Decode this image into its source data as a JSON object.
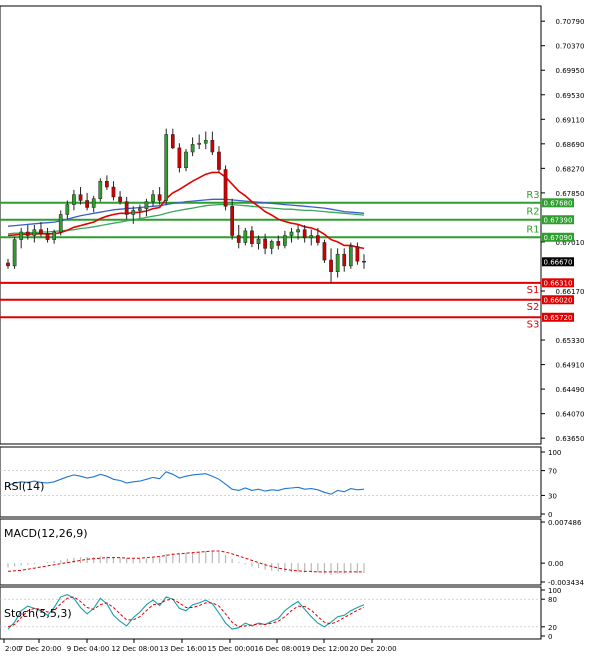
{
  "chart_data": {
    "type": "candlestick",
    "main": {
      "y_ticks": [
        "0.70790",
        "0.70370",
        "0.69950",
        "0.69530",
        "0.69110",
        "0.68690",
        "0.68270",
        "0.67850",
        "0.67010",
        "0.66170",
        "0.65330",
        "0.64910",
        "0.64490",
        "0.64070",
        "0.63650"
      ],
      "ylim": [
        0.6355,
        0.7105
      ],
      "x_ticks": [
        "2:00",
        "7 Dec 20:00",
        "9 Dec 04:00",
        "12 Dec 08:00",
        "13 Dec 16:00",
        "15 Dec 00:00",
        "16 Dec 08:00",
        "19 Dec 12:00",
        "20 Dec 20:00"
      ],
      "current_price": "0.66670",
      "levels": [
        {
          "label": "R3",
          "value": 0.6768,
          "tag": "0.67680",
          "color": "#2e9e2e"
        },
        {
          "label": "R2",
          "value": 0.6739,
          "tag": "0.67390",
          "color": "#2e9e2e"
        },
        {
          "label": "R1",
          "value": 0.6709,
          "tag": "0.67090",
          "color": "#2e9e2e"
        },
        {
          "label": "S1",
          "value": 0.6631,
          "tag": "0.66310",
          "color": "#e00000"
        },
        {
          "label": "S2",
          "value": 0.6602,
          "tag": "0.66020",
          "color": "#e00000"
        },
        {
          "label": "S3",
          "value": 0.6572,
          "tag": "0.65720",
          "color": "#e00000"
        }
      ],
      "candles": [
        [
          0.6665,
          0.6672,
          0.6655,
          0.666
        ],
        [
          0.666,
          0.671,
          0.6655,
          0.6705
        ],
        [
          0.6705,
          0.6725,
          0.669,
          0.6718
        ],
        [
          0.6718,
          0.673,
          0.6705,
          0.6712
        ],
        [
          0.6712,
          0.673,
          0.67,
          0.6722
        ],
        [
          0.6722,
          0.6735,
          0.671,
          0.6715
        ],
        [
          0.6715,
          0.6725,
          0.67,
          0.6705
        ],
        [
          0.6705,
          0.6722,
          0.6698,
          0.6718
        ],
        [
          0.6718,
          0.6755,
          0.6712,
          0.6748
        ],
        [
          0.6748,
          0.6772,
          0.674,
          0.6765
        ],
        [
          0.6765,
          0.679,
          0.6755,
          0.6782
        ],
        [
          0.6782,
          0.6795,
          0.6765,
          0.6772
        ],
        [
          0.6772,
          0.6785,
          0.6755,
          0.676
        ],
        [
          0.676,
          0.678,
          0.6752,
          0.6775
        ],
        [
          0.6775,
          0.681,
          0.677,
          0.6805
        ],
        [
          0.6805,
          0.6815,
          0.679,
          0.6795
        ],
        [
          0.6795,
          0.6805,
          0.6772,
          0.6778
        ],
        [
          0.6778,
          0.6788,
          0.6765,
          0.677
        ],
        [
          0.677,
          0.6778,
          0.674,
          0.6748
        ],
        [
          0.6748,
          0.6762,
          0.6732,
          0.6755
        ],
        [
          0.6755,
          0.6765,
          0.6742,
          0.6758
        ],
        [
          0.6758,
          0.6775,
          0.6745,
          0.677
        ],
        [
          0.677,
          0.679,
          0.6762,
          0.6782
        ],
        [
          0.6782,
          0.6795,
          0.6765,
          0.6772
        ],
        [
          0.6772,
          0.6895,
          0.6765,
          0.6885
        ],
        [
          0.6885,
          0.6895,
          0.686,
          0.6862
        ],
        [
          0.6862,
          0.687,
          0.682,
          0.6828
        ],
        [
          0.6828,
          0.686,
          0.6822,
          0.6855
        ],
        [
          0.6855,
          0.688,
          0.6848,
          0.6868
        ],
        [
          0.6868,
          0.6885,
          0.686,
          0.687
        ],
        [
          0.687,
          0.689,
          0.686,
          0.6875
        ],
        [
          0.6875,
          0.689,
          0.685,
          0.6855
        ],
        [
          0.6855,
          0.6865,
          0.682,
          0.6825
        ],
        [
          0.6825,
          0.6832,
          0.6755,
          0.6762
        ],
        [
          0.6762,
          0.6775,
          0.6705,
          0.6712
        ],
        [
          0.6712,
          0.673,
          0.669,
          0.67
        ],
        [
          0.67,
          0.6725,
          0.6695,
          0.672
        ],
        [
          0.672,
          0.6728,
          0.6692,
          0.6698
        ],
        [
          0.6698,
          0.6712,
          0.6688,
          0.6706
        ],
        [
          0.6706,
          0.6715,
          0.668,
          0.669
        ],
        [
          0.669,
          0.6705,
          0.668,
          0.6702
        ],
        [
          0.6702,
          0.6712,
          0.6688,
          0.6695
        ],
        [
          0.6695,
          0.672,
          0.669,
          0.6712
        ],
        [
          0.6712,
          0.6725,
          0.67,
          0.6718
        ],
        [
          0.6718,
          0.673,
          0.6705,
          0.6722
        ],
        [
          0.6722,
          0.673,
          0.67,
          0.6708
        ],
        [
          0.6708,
          0.6722,
          0.6695,
          0.6712
        ],
        [
          0.6712,
          0.6725,
          0.6695,
          0.67
        ],
        [
          0.67,
          0.6705,
          0.6665,
          0.667
        ],
        [
          0.667,
          0.669,
          0.663,
          0.665
        ],
        [
          0.665,
          0.669,
          0.664,
          0.668
        ],
        [
          0.668,
          0.669,
          0.665,
          0.666
        ],
        [
          0.666,
          0.67,
          0.6655,
          0.6693
        ],
        [
          0.6693,
          0.67,
          0.6662,
          0.6668
        ],
        [
          0.6668,
          0.668,
          0.6655,
          0.6667
        ]
      ],
      "ema_red": [
        0.6712,
        0.6713,
        0.6714,
        0.6714,
        0.6715,
        0.6715,
        0.6715,
        0.6715,
        0.6717,
        0.6721,
        0.6726,
        0.6729,
        0.6732,
        0.6735,
        0.6741,
        0.6745,
        0.6748,
        0.675,
        0.675,
        0.6751,
        0.6752,
        0.6754,
        0.6758,
        0.676,
        0.6775,
        0.6785,
        0.6791,
        0.6798,
        0.6805,
        0.6811,
        0.6817,
        0.682,
        0.682,
        0.6812,
        0.68,
        0.6788,
        0.678,
        0.677,
        0.6762,
        0.6753,
        0.6747,
        0.674,
        0.6736,
        0.6733,
        0.6731,
        0.6727,
        0.6725,
        0.6721,
        0.6714,
        0.6705,
        0.6701,
        0.6695,
        0.6695,
        0.6692,
        0.669
      ],
      "sma_blue": [
        0.6728,
        0.6729,
        0.673,
        0.6731,
        0.6732,
        0.6733,
        0.6734,
        0.6735,
        0.6737,
        0.674,
        0.6743,
        0.6746,
        0.6748,
        0.675,
        0.6752,
        0.6754,
        0.6756,
        0.6757,
        0.6758,
        0.6759,
        0.676,
        0.6761,
        0.6762,
        0.6763,
        0.6765,
        0.6767,
        0.6768,
        0.677,
        0.6771,
        0.6772,
        0.6773,
        0.6774,
        0.6774,
        0.6774,
        0.6773,
        0.6772,
        0.6771,
        0.677,
        0.6769,
        0.6768,
        0.6767,
        0.6766,
        0.6765,
        0.6764,
        0.6763,
        0.6762,
        0.6761,
        0.676,
        0.6759,
        0.6757,
        0.6755,
        0.6753,
        0.6752,
        0.6751,
        0.675
      ],
      "sma_green": [
        0.6715,
        0.6716,
        0.6716,
        0.6717,
        0.6717,
        0.6718,
        0.6718,
        0.6719,
        0.672,
        0.6721,
        0.6722,
        0.6724,
        0.6725,
        0.6727,
        0.6729,
        0.6731,
        0.6733,
        0.6735,
        0.6737,
        0.6739,
        0.6741,
        0.6743,
        0.6745,
        0.6747,
        0.675,
        0.6753,
        0.6755,
        0.6757,
        0.6759,
        0.6761,
        0.6763,
        0.6764,
        0.6765,
        0.6765,
        0.6765,
        0.6764,
        0.6763,
        0.6762,
        0.6761,
        0.676,
        0.6759,
        0.6758,
        0.6757,
        0.6757,
        0.6756,
        0.6755,
        0.6755,
        0.6754,
        0.6753,
        0.6752,
        0.6751,
        0.675,
        0.6749,
        0.6748,
        0.6747
      ]
    },
    "rsi": {
      "label": "RSI(14)",
      "y_ticks": [
        "100",
        "70",
        "30",
        "0"
      ],
      "values": [
        46,
        50,
        52,
        51,
        53,
        51,
        50,
        52,
        56,
        60,
        63,
        61,
        58,
        60,
        64,
        61,
        56,
        54,
        50,
        52,
        53,
        56,
        59,
        57,
        68,
        64,
        58,
        61,
        63,
        64,
        65,
        61,
        56,
        48,
        40,
        38,
        42,
        38,
        40,
        37,
        39,
        38,
        41,
        42,
        43,
        40,
        41,
        39,
        35,
        32,
        38,
        36,
        41,
        39,
        40
      ]
    },
    "macd": {
      "label": "MACD(12,26,9)",
      "y_ticks": [
        "0.007486",
        "0.00",
        "-0.003434"
      ],
      "signal": [
        -0.0015,
        -0.0014,
        -0.0013,
        -0.0011,
        -0.0009,
        -0.0007,
        -0.0005,
        -0.0003,
        -0.0001,
        0.0001,
        0.0003,
        0.0005,
        0.0007,
        0.0008,
        0.0009,
        0.001,
        0.001,
        0.001,
        0.0009,
        0.0009,
        0.0009,
        0.001,
        0.0011,
        0.0012,
        0.0014,
        0.0016,
        0.0017,
        0.0018,
        0.0019,
        0.002,
        0.0021,
        0.0022,
        0.0022,
        0.002,
        0.0017,
        0.0013,
        0.0009,
        0.0005,
        0.0001,
        -0.0003,
        -0.0006,
        -0.0009,
        -0.0011,
        -0.0013,
        -0.0014,
        -0.0015,
        -0.0015,
        -0.0016,
        -0.0016,
        -0.0016,
        -0.0016,
        -0.0016,
        -0.0016,
        -0.0016,
        -0.0016
      ],
      "hist": [
        -0.0008,
        -0.0006,
        -0.0004,
        -0.0003,
        -0.0002,
        0.0,
        0.0002,
        0.0004,
        0.0006,
        0.0008,
        0.001,
        0.0011,
        0.0011,
        0.0011,
        0.0012,
        0.0012,
        0.0011,
        0.001,
        0.0009,
        0.0008,
        0.0008,
        0.0009,
        0.001,
        0.0011,
        0.0016,
        0.0018,
        0.0018,
        0.0019,
        0.002,
        0.0021,
        0.0022,
        0.0022,
        0.002,
        0.0015,
        0.0008,
        0.0002,
        -0.0002,
        -0.0006,
        -0.0009,
        -0.0012,
        -0.0014,
        -0.0015,
        -0.0016,
        -0.0016,
        -0.0016,
        -0.0017,
        -0.0017,
        -0.0017,
        -0.0019,
        -0.0021,
        -0.0019,
        -0.0019,
        -0.0017,
        -0.0018,
        -0.0018
      ]
    },
    "stoch": {
      "label": "Stoch(5,5,3)",
      "y_ticks": [
        "100",
        "80",
        "20",
        "0"
      ],
      "k": [
        15,
        30,
        55,
        65,
        60,
        55,
        45,
        62,
        85,
        90,
        82,
        62,
        48,
        60,
        82,
        70,
        45,
        32,
        22,
        40,
        52,
        68,
        78,
        66,
        85,
        80,
        60,
        55,
        68,
        72,
        78,
        70,
        50,
        28,
        15,
        18,
        28,
        22,
        28,
        25,
        32,
        38,
        55,
        66,
        75,
        58,
        42,
        28,
        20,
        30,
        42,
        45,
        55,
        62,
        68
      ],
      "d": [
        20,
        25,
        40,
        55,
        60,
        58,
        52,
        55,
        70,
        82,
        85,
        75,
        62,
        58,
        68,
        72,
        62,
        48,
        35,
        35,
        42,
        55,
        68,
        70,
        78,
        80,
        72,
        62,
        62,
        66,
        72,
        72,
        65,
        48,
        30,
        20,
        22,
        24,
        26,
        25,
        28,
        32,
        42,
        55,
        65,
        64,
        56,
        42,
        30,
        26,
        32,
        40,
        48,
        56,
        62
      ]
    }
  }
}
